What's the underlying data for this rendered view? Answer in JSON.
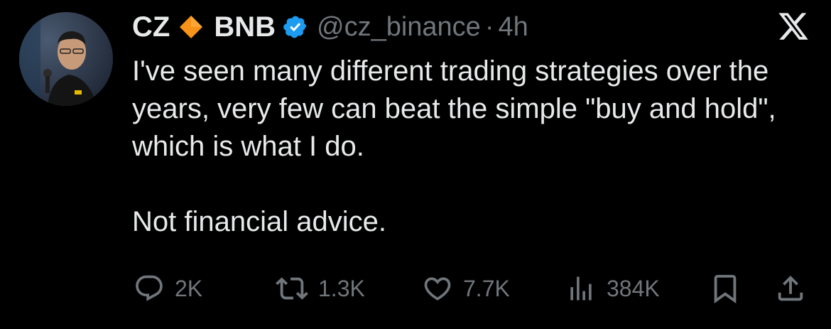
{
  "author": {
    "name_first": "CZ",
    "name_second": "BNB",
    "handle": "@cz_binance",
    "separator": "·",
    "time": "4h",
    "name_icon": "orange-diamond-icon",
    "verified_icon": "verified-badge-icon"
  },
  "app": {
    "logo": "x-logo-icon"
  },
  "tweet": {
    "line1": "I've seen many different trading strategies over the years, very few can beat the simple \"buy and hold\", which is what I do.",
    "line2": "Not financial advice."
  },
  "actions": {
    "replies": {
      "icon": "reply-icon",
      "count": "2K"
    },
    "reposts": {
      "icon": "repost-icon",
      "count": "1.3K"
    },
    "likes": {
      "icon": "heart-icon",
      "count": "7.7K"
    },
    "views": {
      "icon": "analytics-icon",
      "count": "384K"
    },
    "bookmark": {
      "icon": "bookmark-icon"
    },
    "share": {
      "icon": "share-icon"
    }
  },
  "colors": {
    "background": "#000000",
    "text": "#e7e9ea",
    "muted": "#71767b",
    "verified": "#1d9bf0",
    "diamond": "#f7931a"
  }
}
